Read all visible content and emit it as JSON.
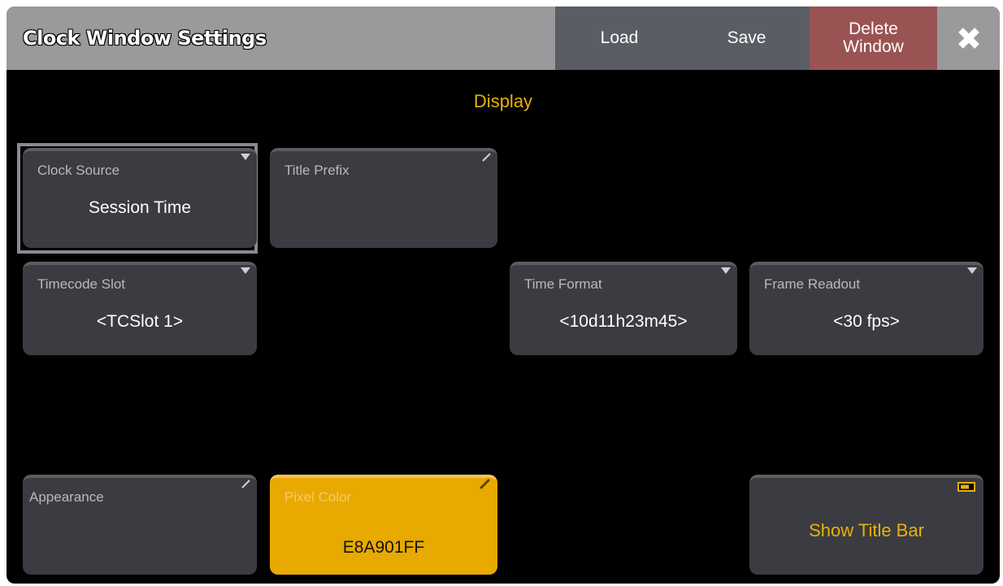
{
  "window": {
    "title": "Clock Window Settings",
    "buttons": {
      "load": "Load",
      "save": "Save",
      "delete_line1": "Delete",
      "delete_line2": "Window",
      "close_icon": "close-x-icon"
    }
  },
  "section": {
    "title": "Display"
  },
  "fields": {
    "clock_source": {
      "label": "Clock Source",
      "value": "Session Time"
    },
    "title_prefix": {
      "label": "Title Prefix",
      "value": ""
    },
    "timecode_slot": {
      "label": "Timecode Slot",
      "value": "<TCSlot 1>"
    },
    "time_format": {
      "label": "Time Format",
      "value": "<10d11h23m45>"
    },
    "frame_readout": {
      "label": "Frame Readout",
      "value": "<30 fps>"
    },
    "appearance": {
      "label": "Appearance",
      "value": ""
    },
    "pixel_color": {
      "label": "Pixel Color",
      "value": "E8A901FF"
    },
    "show_title_bar": {
      "label": "Show Title Bar"
    }
  },
  "colors": {
    "accent": "#e8b208",
    "pixel_color_swatch": "#e8a901",
    "delete_button": "#9a5353",
    "tile_background": "#3b3b42"
  }
}
